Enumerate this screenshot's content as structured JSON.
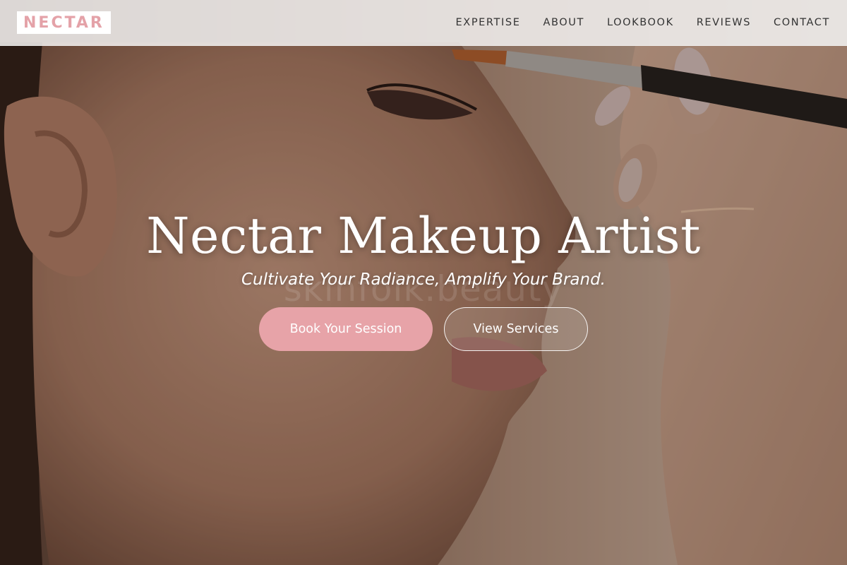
{
  "brand": {
    "logo_text": "NECTAR",
    "accent_color": "#e4a2a8"
  },
  "nav": {
    "items": [
      {
        "label": "EXPERTISE"
      },
      {
        "label": "ABOUT"
      },
      {
        "label": "LOOKBOOK"
      },
      {
        "label": "REVIEWS"
      },
      {
        "label": "CONTACT"
      }
    ]
  },
  "hero": {
    "title": "Nectar Makeup Artist",
    "tagline": "Cultivate Your Radiance, Amplify Your Brand.",
    "watermark": "skinfolk.beauty",
    "primary_button": "Book Your Session",
    "secondary_button": "View Services",
    "primary_button_color": "#e7a3a8"
  }
}
